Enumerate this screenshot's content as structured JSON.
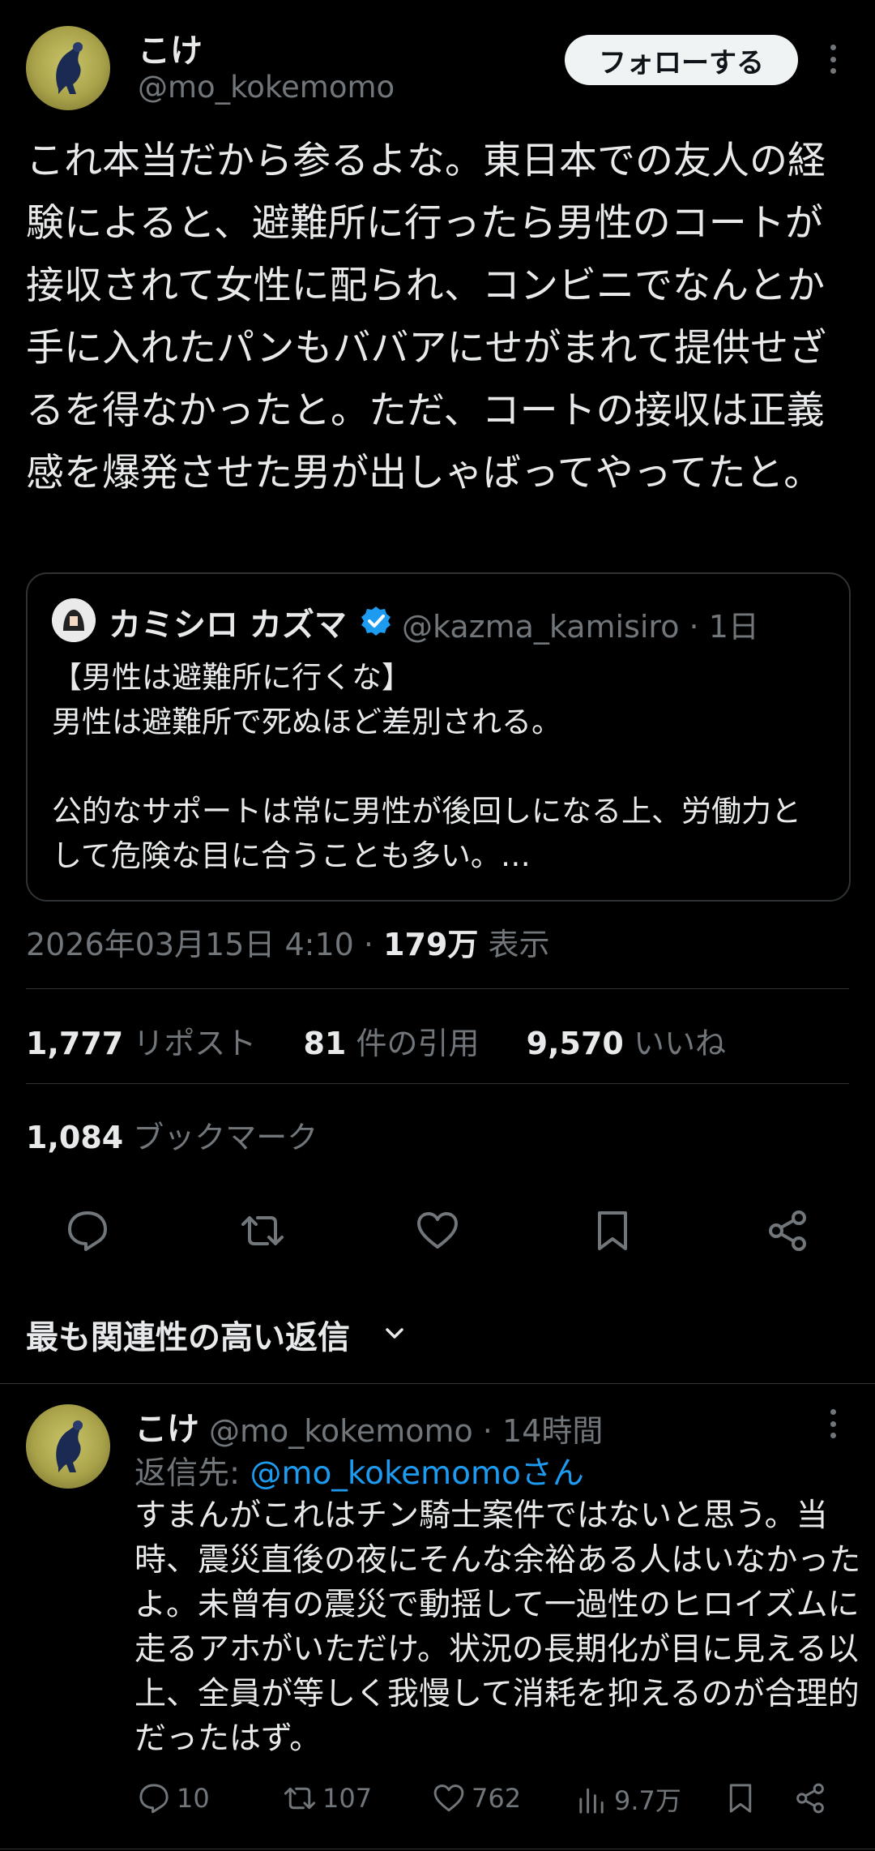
{
  "header": {
    "name": "こけ",
    "handle": "@mo_kokemomo",
    "follow_label": "フォローする"
  },
  "tweet": {
    "text": "これ本当だから参るよな。東日本での友人の経験によると、避難所に行ったら男性のコートが接収されて女性に配られ、コンビニでなんとか手に入れたパンもババアにせがまれて提供せざるを得なかったと。ただ、コートの接収は正義感を爆発させた男が出しゃばってやってたと。",
    "timestamp": "2026年03月15日 4:10 · ",
    "views_count": "179万",
    "views_label": " 表示"
  },
  "quote": {
    "name": "カミシロ カズマ",
    "handle": "@kazma_kamisiro · 1日",
    "text": "【男性は避難所に行くな】\n男性は避難所で死ぬほど差別される。\n\n公的なサポートは常に男性が後回しになる上、労働力として危険な目に合うことも多い。…"
  },
  "stats": {
    "reposts_count": "1,777",
    "reposts_label": " リポスト",
    "quotes_count": "81",
    "quotes_label": " 件の引用",
    "likes_count": "9,570",
    "likes_label": " いいね",
    "bookmarks_count": "1,084",
    "bookmarks_label": " ブックマーク"
  },
  "action_icons": [
    "reply-icon",
    "retweet-icon",
    "like-icon",
    "bookmark-icon",
    "share-icon"
  ],
  "replies": {
    "sort_label": "最も関連性の高い返信"
  },
  "reply": {
    "name": "こけ",
    "handle": "@mo_kokemomo · 14時間",
    "reply_to_prefix": "返信先: ",
    "reply_to_handle": "@mo_kokemomoさん",
    "text": "すまんがこれはチン騎士案件ではないと思う。当時、震災直後の夜にそんな余裕ある人はいなかったよ。未曾有の震災で動揺して一過性のヒロイズムに走るアホがいただけ。状況の長期化が目に見える以上、全員が等しく我慢して消耗を抑えるのが合理的だったはず。",
    "replies": "10",
    "retweets": "107",
    "likes": "762",
    "views": "9.7万"
  },
  "colors": {
    "background": "#000000",
    "text": "#e7e9ea",
    "muted": "#71767b",
    "link": "#1d9bf0",
    "divider": "#2f3336"
  }
}
